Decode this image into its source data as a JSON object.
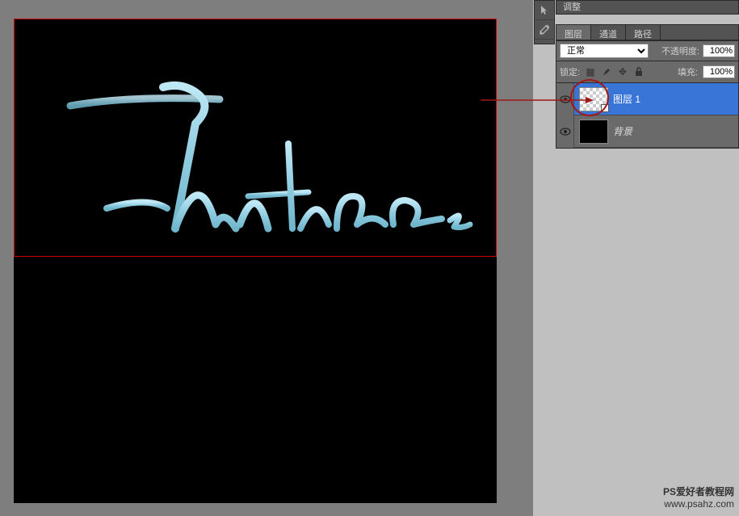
{
  "adjustments_label": "调整",
  "tabs": {
    "layers": "图层",
    "channels": "通道",
    "paths": "路径"
  },
  "blend_mode": "正常",
  "opacity": {
    "label": "不透明度:",
    "value": "100%"
  },
  "lock": {
    "label": "锁定:"
  },
  "fill": {
    "label": "填充:",
    "value": "100%"
  },
  "layers": [
    {
      "name": "图层 1",
      "selected": true,
      "thumb": "checker"
    },
    {
      "name": "背景",
      "selected": false,
      "thumb": "black"
    }
  ],
  "watermark": {
    "line1": "PS爱好者教程网",
    "line2": "www.psahz.com"
  }
}
